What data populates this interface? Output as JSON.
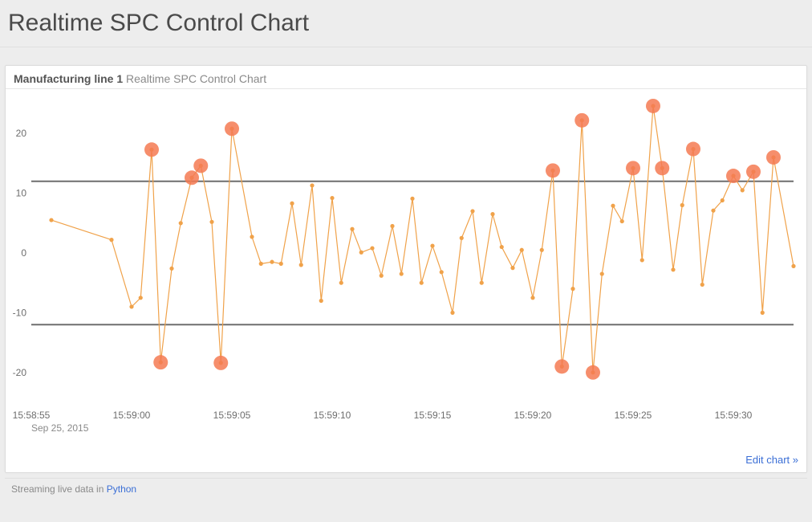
{
  "header": {
    "title": "Realtime SPC Control Chart"
  },
  "panel": {
    "title_line": "Manufacturing line 1",
    "title_rest": "Realtime SPC Control Chart",
    "edit_link": "Edit chart »"
  },
  "footer": {
    "stream_prefix": "Streaming live data in ",
    "stream_lang": "Python"
  },
  "chart_data": {
    "type": "line",
    "title": "",
    "xlabel": "",
    "ylabel": "",
    "ylim": [
      -25,
      25
    ],
    "y_ticks": [
      -20,
      -10,
      0,
      10,
      20
    ],
    "x_ticks": [
      "15:58:55",
      "15:59:00",
      "15:59:05",
      "15:59:10",
      "15:59:15",
      "15:59:20",
      "15:59:25",
      "15:59:30"
    ],
    "x_date": "Sep 25, 2015",
    "x_visible_start": "15:58:55",
    "x_visible_end": "15:59:33",
    "ucl": 12,
    "lcl": -12,
    "series": [
      {
        "name": "measurement",
        "color": "#f0a24a",
        "points": [
          {
            "t": "15:58:56",
            "v": 5.5
          },
          {
            "t": "15:58:59",
            "v": 2.2
          },
          {
            "t": "15:59:00",
            "v": -9.0
          },
          {
            "t": "15:59:00",
            "v": -7.5
          },
          {
            "t": "15:59:01",
            "v": 17.3,
            "ooc": true
          },
          {
            "t": "15:59:01",
            "v": -18.3,
            "ooc": true
          },
          {
            "t": "15:59:02",
            "v": -2.6
          },
          {
            "t": "15:59:02",
            "v": 5.0
          },
          {
            "t": "15:59:03",
            "v": 12.6,
            "ooc": true
          },
          {
            "t": "15:59:03",
            "v": 14.6,
            "ooc": true
          },
          {
            "t": "15:59:04",
            "v": 5.2
          },
          {
            "t": "15:59:04",
            "v": -18.4,
            "ooc": true
          },
          {
            "t": "15:59:05",
            "v": 20.8,
            "ooc": true
          },
          {
            "t": "15:59:06",
            "v": 2.7
          },
          {
            "t": "15:59:06",
            "v": -1.8
          },
          {
            "t": "15:59:07",
            "v": -1.5
          },
          {
            "t": "15:59:07",
            "v": -1.8
          },
          {
            "t": "15:59:08",
            "v": 8.3
          },
          {
            "t": "15:59:08",
            "v": -2.0
          },
          {
            "t": "15:59:09",
            "v": 11.3
          },
          {
            "t": "15:59:09",
            "v": -8.0
          },
          {
            "t": "15:59:10",
            "v": 9.2
          },
          {
            "t": "15:59:10",
            "v": -5.0
          },
          {
            "t": "15:59:11",
            "v": 4.0
          },
          {
            "t": "15:59:11",
            "v": 0.1
          },
          {
            "t": "15:59:12",
            "v": 0.8
          },
          {
            "t": "15:59:12",
            "v": -3.8
          },
          {
            "t": "15:59:13",
            "v": 4.5
          },
          {
            "t": "15:59:13",
            "v": -3.5
          },
          {
            "t": "15:59:14",
            "v": 9.1
          },
          {
            "t": "15:59:14",
            "v": -5.0
          },
          {
            "t": "15:59:15",
            "v": 1.2
          },
          {
            "t": "15:59:15",
            "v": -3.2
          },
          {
            "t": "15:59:16",
            "v": -10.0
          },
          {
            "t": "15:59:16",
            "v": 2.5
          },
          {
            "t": "15:59:17",
            "v": 7.0
          },
          {
            "t": "15:59:17",
            "v": -5.0
          },
          {
            "t": "15:59:18",
            "v": 6.5
          },
          {
            "t": "15:59:18",
            "v": 1.0
          },
          {
            "t": "15:59:19",
            "v": -2.5
          },
          {
            "t": "15:59:19",
            "v": 0.5
          },
          {
            "t": "15:59:20",
            "v": -7.5
          },
          {
            "t": "15:59:20",
            "v": 0.5
          },
          {
            "t": "15:59:21",
            "v": 13.8,
            "ooc": true
          },
          {
            "t": "15:59:21",
            "v": -19.0,
            "ooc": true
          },
          {
            "t": "15:59:22",
            "v": -6.0
          },
          {
            "t": "15:59:22",
            "v": 22.2,
            "ooc": true
          },
          {
            "t": "15:59:23",
            "v": -20.0,
            "ooc": true
          },
          {
            "t": "15:59:23",
            "v": -3.5
          },
          {
            "t": "15:59:24",
            "v": 7.9
          },
          {
            "t": "15:59:24",
            "v": 5.3
          },
          {
            "t": "15:59:25",
            "v": 14.2,
            "ooc": true
          },
          {
            "t": "15:59:25",
            "v": -1.2
          },
          {
            "t": "15:59:26",
            "v": 24.6,
            "ooc": true
          },
          {
            "t": "15:59:26",
            "v": 14.2,
            "ooc": true
          },
          {
            "t": "15:59:27",
            "v": -2.8
          },
          {
            "t": "15:59:27",
            "v": 8.0
          },
          {
            "t": "15:59:28",
            "v": 17.4,
            "ooc": true
          },
          {
            "t": "15:59:28",
            "v": -5.3
          },
          {
            "t": "15:59:29",
            "v": 7.1
          },
          {
            "t": "15:59:29",
            "v": 8.8
          },
          {
            "t": "15:59:30",
            "v": 12.9,
            "ooc": true
          },
          {
            "t": "15:59:30",
            "v": 10.5
          },
          {
            "t": "15:59:31",
            "v": 13.6,
            "ooc": true
          },
          {
            "t": "15:59:31",
            "v": -10.0
          },
          {
            "t": "15:59:32",
            "v": 16.0,
            "ooc": true
          },
          {
            "t": "15:59:33",
            "v": -2.2
          }
        ]
      }
    ]
  }
}
